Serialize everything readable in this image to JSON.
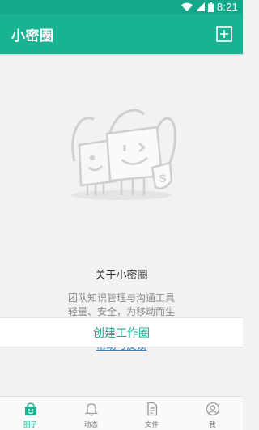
{
  "status_bar": {
    "time": "8:21"
  },
  "app_bar": {
    "title": "小密圈"
  },
  "main": {
    "about_title": "关于小密圈",
    "desc_line1": "团队知识管理与沟通工具",
    "desc_line2": "轻量、安全，为移动而生",
    "help_link": "帮助与反馈",
    "create_button": "创建工作圈"
  },
  "bottom_nav": {
    "items": [
      {
        "label": "圈子",
        "icon": "circle-bag-icon",
        "active": true
      },
      {
        "label": "动态",
        "icon": "bell-icon",
        "active": false
      },
      {
        "label": "文件",
        "icon": "document-icon",
        "active": false
      },
      {
        "label": "我",
        "icon": "user-icon",
        "active": false
      }
    ]
  },
  "colors": {
    "primary": "#19b392",
    "status_bar": "#14a88a",
    "link": "#2e7bc4",
    "background": "#f2f2f2"
  }
}
